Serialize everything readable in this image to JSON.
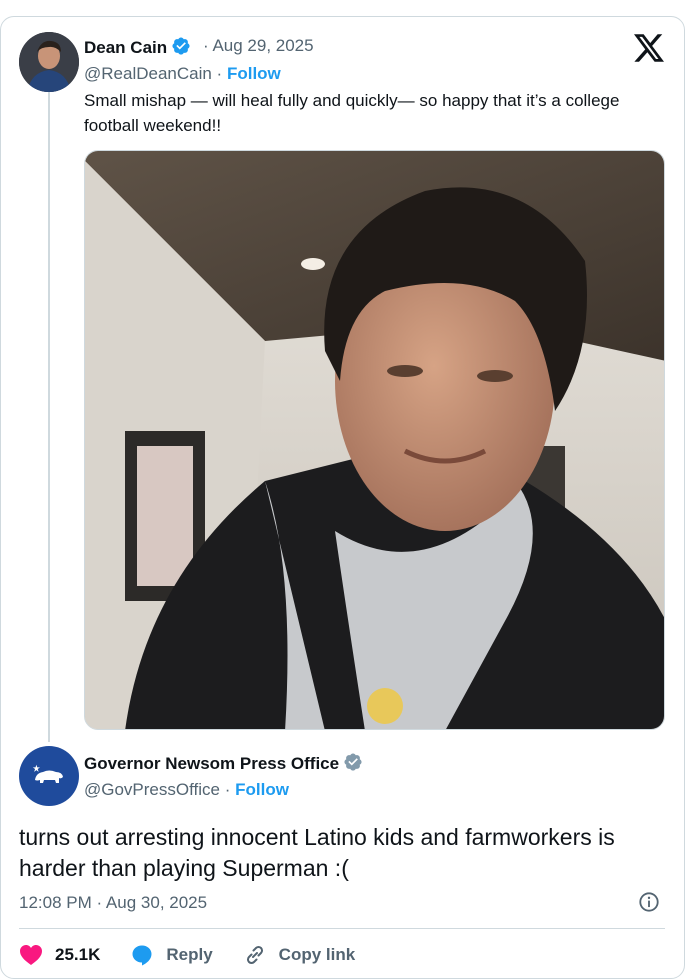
{
  "tweet1": {
    "name": "Dean Cain",
    "date": "· Aug 29, 2025",
    "handle": "@RealDeanCain ·",
    "follow": "Follow",
    "text": "Small mishap — will heal fully and quickly— so happy that it’s a college football weekend!!"
  },
  "tweet2": {
    "name": "Governor Newsom Press Office",
    "handle": "@GovPressOffice ·",
    "follow": "Follow",
    "text": "turns out arresting innocent Latino kids and farmworkers is harder than playing Superman :(",
    "timestamp": "12:08 PM · Aug 30, 2025"
  },
  "actions": {
    "likes": "25.1K",
    "reply": "Reply",
    "copy_link": "Copy link"
  },
  "colors": {
    "verified_blue": "#1d9bf0",
    "verified_gray": "#829aab",
    "heart": "#f91880",
    "reply_bubble": "#1d9bf0"
  }
}
